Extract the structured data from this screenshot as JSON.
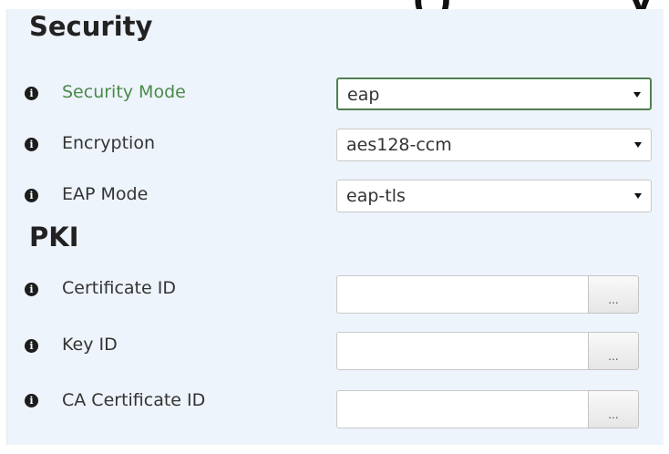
{
  "sections": {
    "security": {
      "title": "Security"
    },
    "pki": {
      "title": "PKI"
    }
  },
  "security_fields": {
    "mode": {
      "label": "Security Mode",
      "value": "eap"
    },
    "encryption": {
      "label": "Encryption",
      "value": "aes128-ccm"
    },
    "eap_mode": {
      "label": "EAP Mode",
      "value": "eap-tls"
    }
  },
  "pki_fields": {
    "certificate_id": {
      "label": "Certificate ID",
      "value": "",
      "button": "..."
    },
    "key_id": {
      "label": "Key ID",
      "value": "",
      "button": "..."
    },
    "ca_certificate_id": {
      "label": "CA Certificate ID",
      "value": "",
      "button": "..."
    }
  },
  "icons": {
    "info": "info-circle-icon",
    "info_glyph": "i",
    "caret": "caret-down-icon"
  },
  "colors": {
    "active_label": "#4a8a4a",
    "focused_border": "#4f7f4f",
    "panel_bg": "#eef4fb"
  }
}
